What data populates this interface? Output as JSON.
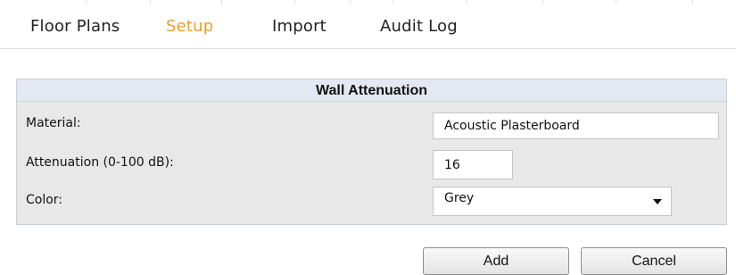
{
  "tabs": [
    {
      "label": "Floor Plans",
      "active": false
    },
    {
      "label": "Setup",
      "active": true
    },
    {
      "label": "Import",
      "active": false
    },
    {
      "label": "Audit Log",
      "active": false
    }
  ],
  "colors": {
    "active_tab": "#f39a2b",
    "panel_bg": "#e8e8e8",
    "header_bg": "#e4e8f2"
  },
  "panel": {
    "title": "Wall Attenuation",
    "material": {
      "label": "Material:",
      "value": "Acoustic Plasterboard"
    },
    "attenuation": {
      "label": "Attenuation (0-100 dB):",
      "value": "16"
    },
    "color": {
      "label": "Color:",
      "value": "Grey"
    }
  },
  "buttons": {
    "add": "Add",
    "cancel": "Cancel"
  }
}
